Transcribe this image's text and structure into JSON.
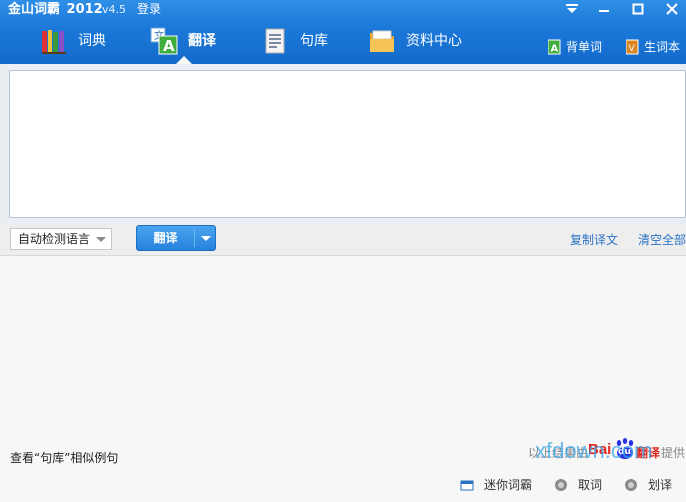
{
  "app": {
    "title": "金山词霸",
    "year": "2012",
    "version": "v4.5",
    "login_label": "登录"
  },
  "window_controls": {
    "menu_icon": "dropdown-arrow-icon",
    "minimize_icon": "minimize-icon",
    "maximize_icon": "maximize-icon",
    "close_icon": "close-icon"
  },
  "tabs": [
    {
      "label": "词典",
      "icon": "books-icon",
      "active": false
    },
    {
      "label": "翻译",
      "icon": "translate-icon",
      "active": true
    },
    {
      "label": "句库",
      "icon": "document-icon",
      "active": false
    },
    {
      "label": "资料中心",
      "icon": "folder-icon",
      "active": false
    }
  ],
  "header_links": {
    "memorize": "背单词",
    "vocab": "生词本"
  },
  "input": {
    "value": "",
    "placeholder": ""
  },
  "toolbar": {
    "language_select": "自动检测语言",
    "translate_button": "翻译",
    "copy_link": "复制译文",
    "clear_link": "清空全部"
  },
  "output": {
    "example_link": "查看“句库”相似例句",
    "provider_prefix": "以上结果由",
    "provider_logo_text": "Bai",
    "provider_logo_du": "du",
    "provider_logo_fanyi": "翻译",
    "provider_suffix": "提供"
  },
  "bottom_bar": {
    "mini": "迷你词霸",
    "fetch_word": "取词",
    "select_word": "划译"
  },
  "watermark": "xfdown.com",
  "colors": {
    "header_blue": "#1b78d8",
    "link_blue": "#2a73c4",
    "baidu_red": "#e1251b",
    "baidu_blue": "#2932e1"
  }
}
